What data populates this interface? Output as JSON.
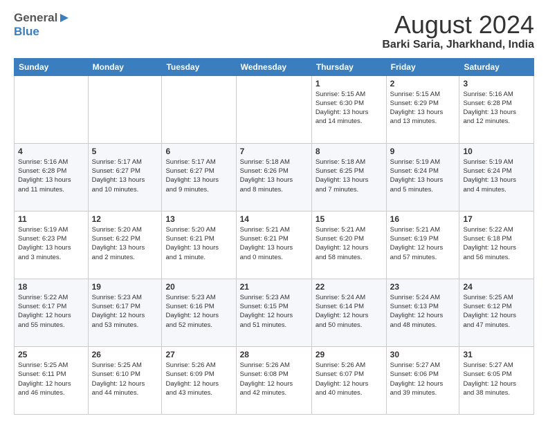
{
  "header": {
    "logo_line1_part1": "General",
    "logo_line1_part2": "▶",
    "logo_line2": "Blue",
    "month": "August 2024",
    "location": "Barki Saria, Jharkhand, India"
  },
  "weekdays": [
    "Sunday",
    "Monday",
    "Tuesday",
    "Wednesday",
    "Thursday",
    "Friday",
    "Saturday"
  ],
  "weeks": [
    [
      {
        "day": "",
        "info": ""
      },
      {
        "day": "",
        "info": ""
      },
      {
        "day": "",
        "info": ""
      },
      {
        "day": "",
        "info": ""
      },
      {
        "day": "1",
        "info": "Sunrise: 5:15 AM\nSunset: 6:30 PM\nDaylight: 13 hours\nand 14 minutes."
      },
      {
        "day": "2",
        "info": "Sunrise: 5:15 AM\nSunset: 6:29 PM\nDaylight: 13 hours\nand 13 minutes."
      },
      {
        "day": "3",
        "info": "Sunrise: 5:16 AM\nSunset: 6:28 PM\nDaylight: 13 hours\nand 12 minutes."
      }
    ],
    [
      {
        "day": "4",
        "info": "Sunrise: 5:16 AM\nSunset: 6:28 PM\nDaylight: 13 hours\nand 11 minutes."
      },
      {
        "day": "5",
        "info": "Sunrise: 5:17 AM\nSunset: 6:27 PM\nDaylight: 13 hours\nand 10 minutes."
      },
      {
        "day": "6",
        "info": "Sunrise: 5:17 AM\nSunset: 6:27 PM\nDaylight: 13 hours\nand 9 minutes."
      },
      {
        "day": "7",
        "info": "Sunrise: 5:18 AM\nSunset: 6:26 PM\nDaylight: 13 hours\nand 8 minutes."
      },
      {
        "day": "8",
        "info": "Sunrise: 5:18 AM\nSunset: 6:25 PM\nDaylight: 13 hours\nand 7 minutes."
      },
      {
        "day": "9",
        "info": "Sunrise: 5:19 AM\nSunset: 6:24 PM\nDaylight: 13 hours\nand 5 minutes."
      },
      {
        "day": "10",
        "info": "Sunrise: 5:19 AM\nSunset: 6:24 PM\nDaylight: 13 hours\nand 4 minutes."
      }
    ],
    [
      {
        "day": "11",
        "info": "Sunrise: 5:19 AM\nSunset: 6:23 PM\nDaylight: 13 hours\nand 3 minutes."
      },
      {
        "day": "12",
        "info": "Sunrise: 5:20 AM\nSunset: 6:22 PM\nDaylight: 13 hours\nand 2 minutes."
      },
      {
        "day": "13",
        "info": "Sunrise: 5:20 AM\nSunset: 6:21 PM\nDaylight: 13 hours\nand 1 minute."
      },
      {
        "day": "14",
        "info": "Sunrise: 5:21 AM\nSunset: 6:21 PM\nDaylight: 13 hours\nand 0 minutes."
      },
      {
        "day": "15",
        "info": "Sunrise: 5:21 AM\nSunset: 6:20 PM\nDaylight: 12 hours\nand 58 minutes."
      },
      {
        "day": "16",
        "info": "Sunrise: 5:21 AM\nSunset: 6:19 PM\nDaylight: 12 hours\nand 57 minutes."
      },
      {
        "day": "17",
        "info": "Sunrise: 5:22 AM\nSunset: 6:18 PM\nDaylight: 12 hours\nand 56 minutes."
      }
    ],
    [
      {
        "day": "18",
        "info": "Sunrise: 5:22 AM\nSunset: 6:17 PM\nDaylight: 12 hours\nand 55 minutes."
      },
      {
        "day": "19",
        "info": "Sunrise: 5:23 AM\nSunset: 6:17 PM\nDaylight: 12 hours\nand 53 minutes."
      },
      {
        "day": "20",
        "info": "Sunrise: 5:23 AM\nSunset: 6:16 PM\nDaylight: 12 hours\nand 52 minutes."
      },
      {
        "day": "21",
        "info": "Sunrise: 5:23 AM\nSunset: 6:15 PM\nDaylight: 12 hours\nand 51 minutes."
      },
      {
        "day": "22",
        "info": "Sunrise: 5:24 AM\nSunset: 6:14 PM\nDaylight: 12 hours\nand 50 minutes."
      },
      {
        "day": "23",
        "info": "Sunrise: 5:24 AM\nSunset: 6:13 PM\nDaylight: 12 hours\nand 48 minutes."
      },
      {
        "day": "24",
        "info": "Sunrise: 5:25 AM\nSunset: 6:12 PM\nDaylight: 12 hours\nand 47 minutes."
      }
    ],
    [
      {
        "day": "25",
        "info": "Sunrise: 5:25 AM\nSunset: 6:11 PM\nDaylight: 12 hours\nand 46 minutes."
      },
      {
        "day": "26",
        "info": "Sunrise: 5:25 AM\nSunset: 6:10 PM\nDaylight: 12 hours\nand 44 minutes."
      },
      {
        "day": "27",
        "info": "Sunrise: 5:26 AM\nSunset: 6:09 PM\nDaylight: 12 hours\nand 43 minutes."
      },
      {
        "day": "28",
        "info": "Sunrise: 5:26 AM\nSunset: 6:08 PM\nDaylight: 12 hours\nand 42 minutes."
      },
      {
        "day": "29",
        "info": "Sunrise: 5:26 AM\nSunset: 6:07 PM\nDaylight: 12 hours\nand 40 minutes."
      },
      {
        "day": "30",
        "info": "Sunrise: 5:27 AM\nSunset: 6:06 PM\nDaylight: 12 hours\nand 39 minutes."
      },
      {
        "day": "31",
        "info": "Sunrise: 5:27 AM\nSunset: 6:05 PM\nDaylight: 12 hours\nand 38 minutes."
      }
    ]
  ]
}
